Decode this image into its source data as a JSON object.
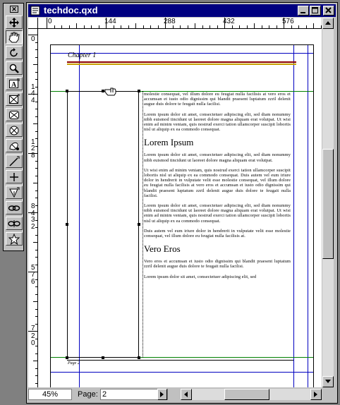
{
  "window": {
    "title": "techdoc.qxd"
  },
  "palette": {
    "close_label": "✕",
    "tools": [
      {
        "name": "item-tool",
        "active": false
      },
      {
        "name": "content-tool",
        "active": true
      },
      {
        "name": "rotation-tool",
        "active": false
      },
      {
        "name": "zoom-tool",
        "active": false
      },
      {
        "name": "text-box-tool",
        "active": false
      },
      {
        "name": "rectangle-picture-box-tool",
        "active": false
      },
      {
        "name": "rounded-picture-box-tool",
        "active": false
      },
      {
        "name": "oval-picture-box-tool",
        "active": false
      },
      {
        "name": "bezier-picture-box-tool",
        "active": false
      },
      {
        "name": "line-tool",
        "active": false
      },
      {
        "name": "orthogonal-line-tool",
        "active": false
      },
      {
        "name": "bezier-line-tool",
        "active": false
      },
      {
        "name": "linking-tool",
        "active": false
      },
      {
        "name": "unlinking-tool",
        "active": false
      },
      {
        "name": "starburst-tool",
        "active": false
      }
    ]
  },
  "rulers": {
    "horizontal": [
      "0",
      "144",
      "288",
      "432",
      "576"
    ],
    "vertical": [
      "0",
      "1",
      "4",
      "4",
      "1",
      "2",
      "8",
      "8",
      "4",
      "3",
      "2",
      "5",
      "7",
      "6",
      "7",
      "2",
      "0"
    ]
  },
  "document": {
    "chapter_title": "Chapter 1",
    "footer": "Page 2",
    "paragraphs": [
      "molestie consequat, vel illum dolore eu feugiat nulla facilisis at vero eros et accumsan et iusto odio dignissim qui blandit praesent luptatum zzril delenit augue duis dolore te feugait nulla facilisi.",
      "Lorem ipsum dolor sit amet, consectetuer adipiscing elit, sed diam nonummy nibh euismod tincidunt ut laoreet dolore magna aliquam erat volutpat. Ut wisi enim ad minim veniam, quis nostrud exerci tation ullamcorper suscipit lobortis nisl ut aliquip ex ea commodo consequat.",
      "Lorem ipsum dolor sit amet, consectetuer adipiscing elit, sed diam nonummy nibh euismod tincidunt ut laoreet dolore magna aliquam erat volutpat.",
      "Ut wisi enim ad minim veniam, quis nostrud exerci tation ullamcorper suscipit lobortis nisl ut aliquip ex ea commodo consequat. Duis autem vel eum iriure dolor in hendrerit in vulputate velit esse molestie consequat, vel illum dolore eu feugiat nulla facilisis at vero eros et accumsan et iusto odio dignissim qui blandit praesent luptatum zzril delenit augue duis dolore te feugait nulla facilisi.",
      "Lorem ipsum dolor sit amet, consectetuer adipiscing elit, sed diam nonummy nibh euismod tincidunt ut laoreet dolore magna aliquam erat volutpat. Ut wisi enim ad minim veniam, quis nostrud exerci tation ullamcorper suscipit lobortis nisl ut aliquip ex ea commodo consequat.",
      "Duis autem vel eum iriure dolor in hendrerit in vulputate velit esse molestie consequat, vel illum dolore eu feugiat nulla facilisis at.",
      "Vero eros et accumsan et iusto odio dignissim qui blandit praesent luptatum zzril delenit augue duis dolore te feugait nulla facilisi.",
      "Lorem ipsum dolor sit amet, consectetuer adipiscing elit, sed"
    ],
    "headings": [
      "Lorem Ipsum",
      "Vero Eros"
    ]
  },
  "status": {
    "zoom": "45%",
    "page_label": "Page:",
    "page_value": "2"
  },
  "colors": {
    "titlebar": "#000080",
    "margin_guide": "#0000c0",
    "ruler_guide": "#008000",
    "chapter_rule_1": "#8b0000",
    "chapter_rule_2": "#c8a000"
  }
}
